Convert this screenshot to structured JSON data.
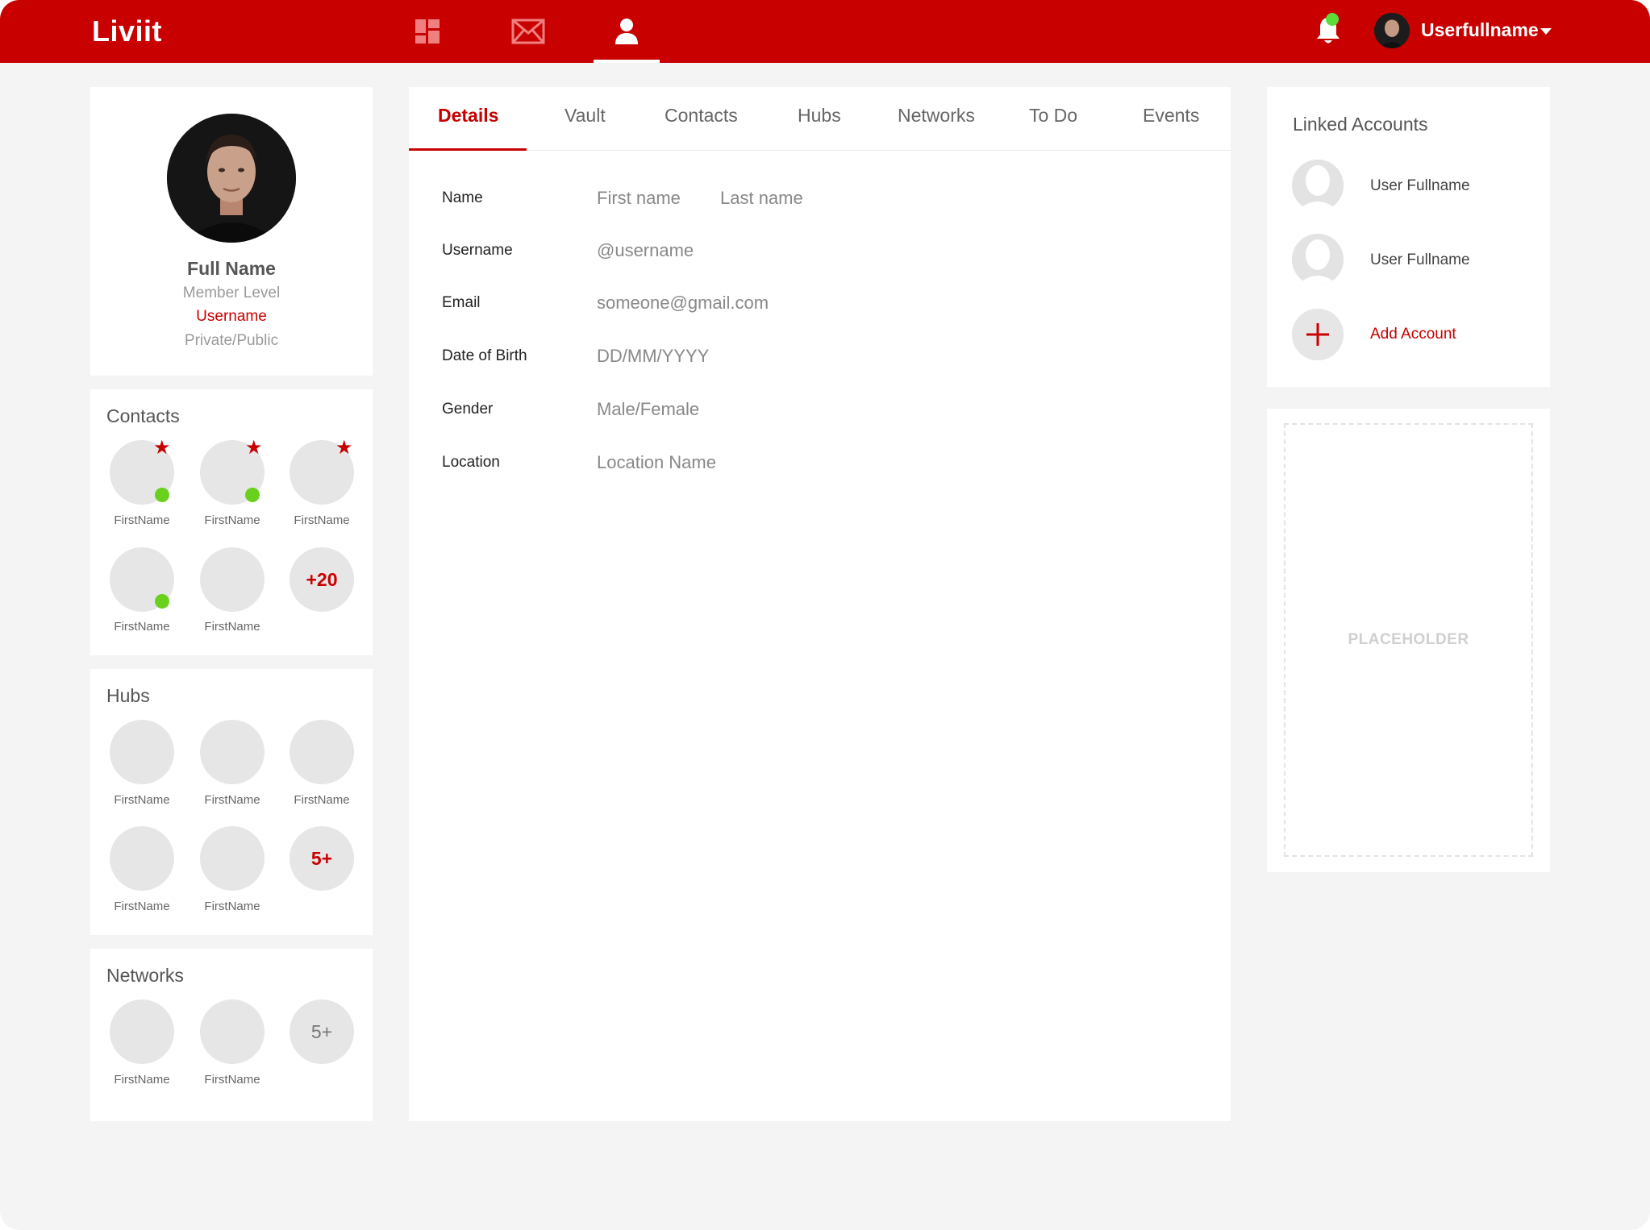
{
  "app": {
    "brand": "Liviit"
  },
  "topbar": {
    "nav": [
      {
        "icon": "dashboard-icon",
        "active": false
      },
      {
        "icon": "mail-icon",
        "active": false
      },
      {
        "icon": "profile-icon",
        "active": true
      }
    ],
    "user_name": "Userfullname"
  },
  "profile": {
    "full_name": "Full Name",
    "member_level": "Member Level",
    "username": "Username",
    "privacy": "Private/Public"
  },
  "contacts": {
    "title": "Contacts",
    "items": [
      {
        "name": "FirstName",
        "starred": true,
        "online": true
      },
      {
        "name": "FirstName",
        "starred": true,
        "online": true
      },
      {
        "name": "FirstName",
        "starred": true,
        "online": false
      },
      {
        "name": "FirstName",
        "starred": false,
        "online": true
      },
      {
        "name": "FirstName",
        "starred": false,
        "online": false
      }
    ],
    "more": "+20"
  },
  "hubs": {
    "title": "Hubs",
    "items": [
      "FirstName",
      "FirstName",
      "FirstName",
      "FirstName",
      "FirstName"
    ],
    "more": "5+"
  },
  "networks": {
    "title": "Networks",
    "items": [
      "FirstName",
      "FirstName"
    ],
    "more": "5+"
  },
  "tabs": [
    "Details",
    "Vault",
    "Contacts",
    "Hubs",
    "Networks",
    "To Do",
    "Events"
  ],
  "active_tab": "Details",
  "details": {
    "name_label": "Name",
    "first_name": "First name",
    "last_name": "Last name",
    "username_label": "Username",
    "username_value": "@username",
    "email_label": "Email",
    "email_value": "someone@gmail.com",
    "dob_label": "Date of Birth",
    "dob_value": "DD/MM/YYYY",
    "gender_label": "Gender",
    "gender_value": "Male/Female",
    "location_label": "Location",
    "location_value": "Location Name"
  },
  "linked_accounts": {
    "title": "Linked Accounts",
    "accounts": [
      "User Fullname",
      "User Fullname"
    ],
    "add_label": "Add Account"
  },
  "placeholder": {
    "text": "PLACEHOLDER"
  },
  "colors": {
    "brand": "#c80000",
    "background": "#f4f4f4",
    "online": "#69d11e",
    "notification": "#5ddc38"
  }
}
